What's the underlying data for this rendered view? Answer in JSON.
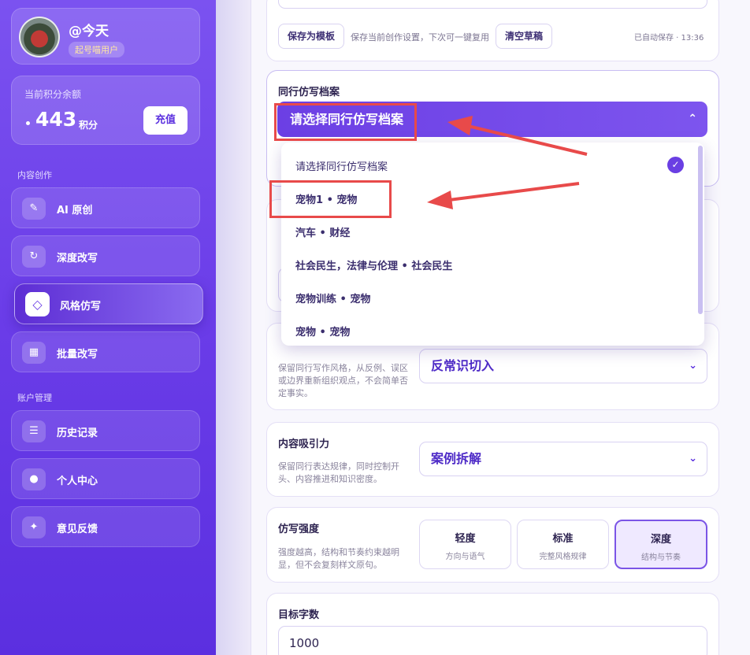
{
  "user": {
    "name": "@今天",
    "badge": "起号喵用户"
  },
  "credits": {
    "label": "当前积分余额",
    "value": "443",
    "unit": "积分",
    "recharge": "充值"
  },
  "nav": {
    "section_create": "内容创作",
    "section_account": "账户管理",
    "items": [
      {
        "label": "AI 原创",
        "icon": "pencil-icon"
      },
      {
        "label": "深度改写",
        "icon": "refresh-icon"
      },
      {
        "label": "风格仿写",
        "icon": "diamond-icon"
      },
      {
        "label": "批量改写",
        "icon": "grid-icon"
      },
      {
        "label": "历史记录",
        "icon": "list-icon"
      },
      {
        "label": "个人中心",
        "icon": "user-icon"
      },
      {
        "label": "意见反馈",
        "icon": "sparkle-icon"
      }
    ]
  },
  "template_bar": {
    "save_label": "保存为模板",
    "hint": "保存当前创作设置，下次可一键复用",
    "clear_label": "清空草稿",
    "autosave": "已自动保存 · 13:36"
  },
  "archive": {
    "label": "同行仿写档案",
    "selected": "请选择同行仿写档案",
    "options": [
      "请选择同行仿写档案",
      "宠物1 • 宠物",
      "汽车 • 财经",
      "社会民生，法律与伦理 • 社会民生",
      "宠物训练 • 宠物",
      "宠物 • 宠物"
    ]
  },
  "angle": {
    "desc": "保留同行写作风格，从反例、误区或边界重新组织观点，不会简单否定事实。",
    "value": "反常识切入"
  },
  "appeal": {
    "label": "内容吸引力",
    "desc": "保留同行表达规律，同时控制开头、内容推进和知识密度。",
    "value": "案例拆解"
  },
  "strength": {
    "label": "仿写强度",
    "desc": "强度越高，结构和节奏约束越明显，但不会复刻样文原句。",
    "options": [
      {
        "title": "轻度",
        "sub": "方向与语气"
      },
      {
        "title": "标准",
        "sub": "完整风格规律"
      },
      {
        "title": "深度",
        "sub": "结构与节奏"
      }
    ]
  },
  "word_count": {
    "label": "目标字数",
    "value": "1000"
  },
  "colors": {
    "accent": "#6b3fe6",
    "annotation": "#e84a4a"
  }
}
